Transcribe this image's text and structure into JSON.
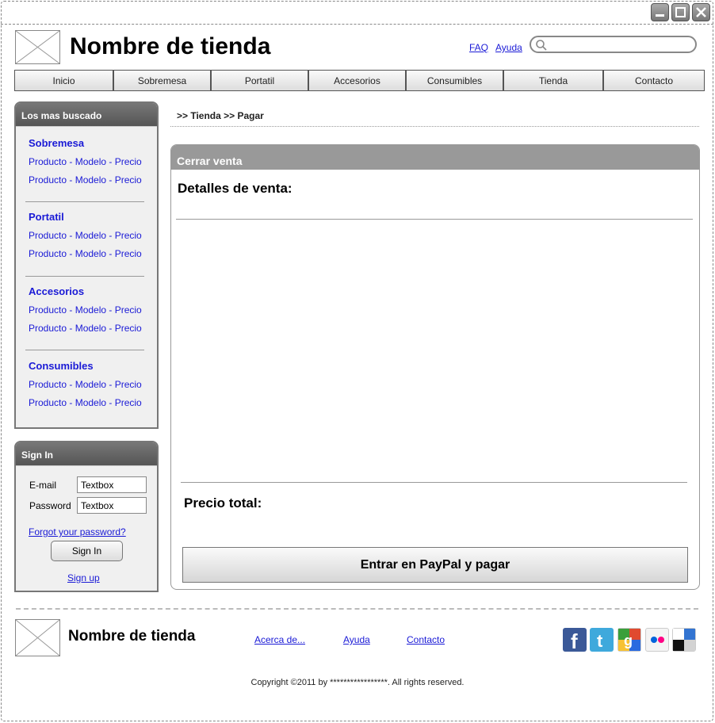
{
  "window": {
    "controls": [
      "minimize-icon",
      "maximize-icon",
      "close-icon"
    ]
  },
  "header": {
    "store_name": "Nombre de tienda",
    "links": [
      "FAQ",
      "Ayuda"
    ],
    "search_placeholder": ""
  },
  "nav": [
    "Inicio",
    "Sobremesa",
    "Portatil",
    "Accesorios",
    "Consumibles",
    "Tienda",
    "Contacto"
  ],
  "sidebar": {
    "popular_title": "Los mas buscado",
    "categories": [
      {
        "title": "Sobremesa",
        "items": [
          "Producto - Modelo - Precio",
          "Producto - Modelo - Precio"
        ]
      },
      {
        "title": "Portatil",
        "items": [
          "Producto - Modelo - Precio",
          "Producto - Modelo - Precio"
        ]
      },
      {
        "title": "Accesorios",
        "items": [
          "Producto - Modelo - Precio",
          "Producto - Modelo - Precio"
        ]
      },
      {
        "title": "Consumibles",
        "items": [
          "Producto - Modelo - Precio",
          "Producto - Modelo - Precio"
        ]
      }
    ],
    "signin": {
      "title": "Sign In",
      "email_label": "E-mail",
      "email_value": "Textbox",
      "password_label": "Password",
      "password_value": "Textbox",
      "forgot": "Forgot your password?",
      "button": "Sign In",
      "signup": "Sign up"
    }
  },
  "main": {
    "breadcrumb": ">> Tienda >> Pagar",
    "sale": {
      "title": "Cerrar venta",
      "details_label": "Detalles de venta:",
      "total_label": "Precio total:",
      "pay_button": "Entrar en PayPal y pagar"
    }
  },
  "footer": {
    "store_name": "Nombre de tienda",
    "links": [
      "Acerca de...",
      "Ayuda",
      "Contacto"
    ],
    "social": [
      "facebook-icon",
      "twitter-icon",
      "google-icon",
      "flickr-icon",
      "delicious-icon"
    ],
    "copyright": "Copyright ©2011 by *****************. All rights reserved."
  },
  "colors": {
    "link": "#1a1ad6",
    "panel_head": "#555555",
    "sale_head": "#999999"
  }
}
